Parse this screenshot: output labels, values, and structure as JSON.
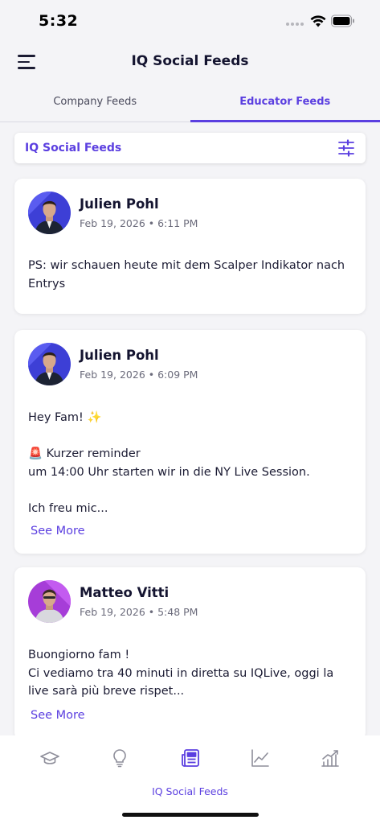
{
  "status": {
    "time": "5:32"
  },
  "header": {
    "title": "IQ Social Feeds",
    "menu_icon": "hamburger-menu-icon"
  },
  "tabs": [
    {
      "label": "Company Feeds",
      "active": false
    },
    {
      "label": "Educator Feeds",
      "active": true
    }
  ],
  "filter": {
    "title": "IQ Social Feeds",
    "icon": "sliders-icon"
  },
  "posts": [
    {
      "author": "Julien Pohl",
      "time": "Feb 19, 2026 • 6:11 PM",
      "body": "PS: wir schauen heute mit dem Scalper Indikator nach Entrys",
      "see_more": ""
    },
    {
      "author": "Julien Pohl",
      "time": "Feb 19, 2026 • 6:09 PM",
      "body": "Hey Fam! ✨\n\n🚨 Kurzer  reminder\num 14:00 Uhr starten wir in die NY Live Session.\n\nIch freu mic...",
      "see_more": "See More"
    },
    {
      "author": "Matteo Vitti",
      "time": "Feb 19, 2026 • 5:48 PM",
      "body": "Buongiorno fam !\nCi vediamo tra 40 minuti in diretta su IQLive, oggi la live sarà più breve rispet...",
      "see_more": "See More"
    }
  ],
  "bottom_nav": {
    "items": [
      {
        "icon": "graduation-cap-icon"
      },
      {
        "icon": "lightbulb-icon"
      },
      {
        "icon": "newspaper-icon",
        "label": "IQ Social Feeds",
        "active": true
      },
      {
        "icon": "line-chart-icon"
      },
      {
        "icon": "bar-chart-trend-icon"
      }
    ]
  },
  "colors": {
    "accent": "#5b3fe0",
    "text": "#141430",
    "muted": "#6b6b7b",
    "background": "#f4f4f7"
  }
}
